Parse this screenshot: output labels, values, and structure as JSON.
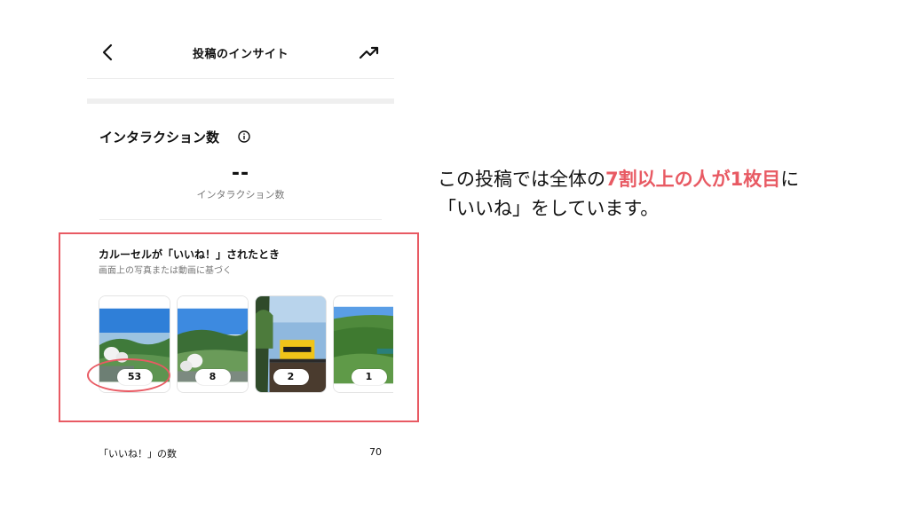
{
  "header": {
    "title": "投稿のインサイト",
    "back_icon": "chevron-left-icon",
    "trend_icon": "trending-up-icon"
  },
  "interactions": {
    "title": "インタラクション数",
    "value": "--",
    "label": "インタラクション数",
    "info_icon": "info-icon"
  },
  "carousel": {
    "title": "カルーセルが「いいね！」されたとき",
    "subtitle": "画面上の写真または動画に基づく",
    "items": [
      {
        "count": "53"
      },
      {
        "count": "8"
      },
      {
        "count": "2"
      },
      {
        "count": "1"
      }
    ]
  },
  "likes": {
    "label": "「いいね！」の数",
    "value": "70"
  },
  "caption": {
    "line1_pre": "この投稿では全体の",
    "line1_highlight": "7割以上の人が1枚目",
    "line1_post": "に",
    "line2": "「いいね」をしています。"
  },
  "colors": {
    "accent": "#e85a63",
    "divider": "#ededed"
  }
}
